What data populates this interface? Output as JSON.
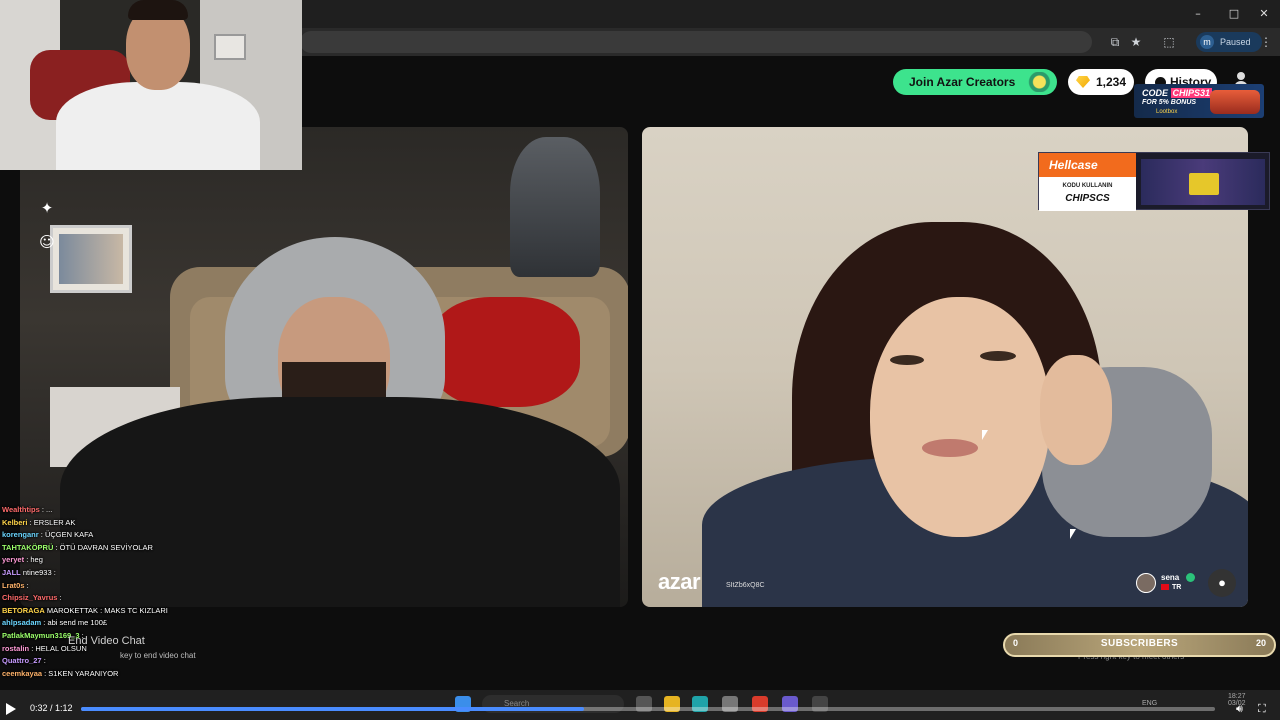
{
  "browser": {
    "window_controls": {
      "minimize": "–",
      "maximize": "□",
      "close": "✕"
    },
    "profile": {
      "initial": "m",
      "label": "Paused"
    },
    "toolbar_icons": [
      "cast-icon",
      "star-icon",
      "extensions-icon",
      "menu-icon"
    ]
  },
  "header": {
    "creators_button": "Join Azar Creators",
    "coins": "1,234",
    "history_button": "History"
  },
  "ads": {
    "lootbox": {
      "code_label": "CODE",
      "code": "CHIPS31",
      "bonus": "FOR 5% BONUS",
      "brand": "Lootbox"
    },
    "hellcase": {
      "brand": "Hellcase",
      "use_text": "KODU KULLANIN",
      "code": "CHIPSCS"
    }
  },
  "video": {
    "logo": "azar",
    "session_id": "SItZb6xQ8C",
    "partner": {
      "name": "sena",
      "country": "TR"
    }
  },
  "chat": {
    "lines": [
      {
        "user": "Wealthtips",
        "msg": ": ..."
      },
      {
        "user": "Kelberi",
        "msg": ": ERSLER AK"
      },
      {
        "user": "korenganr",
        "msg": ": ÜÇGEN KAFA"
      },
      {
        "user": "TAHTAKÖPRÜ",
        "msg": ": ÖTÜ DAVRAN SEVİYOLAR"
      },
      {
        "user": "yeryet",
        "msg": ": heg"
      },
      {
        "user": "JALL",
        "msg": "ntine933 :"
      },
      {
        "user": "Lrat0s",
        "msg": ":"
      },
      {
        "user": "Chipsiz_Yavrus",
        "msg": ":"
      },
      {
        "user": "BETORAGA",
        "msg": "MAROKETTAK : MAKS TC KIZLARI"
      },
      {
        "user": "ahlpsadam",
        "msg": ": abi send me 100£"
      },
      {
        "user": "PatlakMaymun3169_3",
        "msg": ":"
      },
      {
        "user": "rostalin",
        "msg": ": HELAL OLSUN"
      },
      {
        "user": "Quattro_27",
        "msg": ":"
      },
      {
        "user": "ceemkayaa",
        "msg": ": S1KEN YARANIYOR"
      }
    ],
    "end_video_chat": "End Video Chat",
    "end_hint": "key to end video chat",
    "right_hint": "Press right key to meet others"
  },
  "subscribers": {
    "current": "0",
    "label": "SUBSCRIBERS",
    "target": "20"
  },
  "taskbar": {
    "search_placeholder": "Search",
    "lang": "ENG",
    "time": "18:27",
    "date": "03/02"
  },
  "player": {
    "timecode": "0:32 / 1:12",
    "progress": 0.444
  }
}
